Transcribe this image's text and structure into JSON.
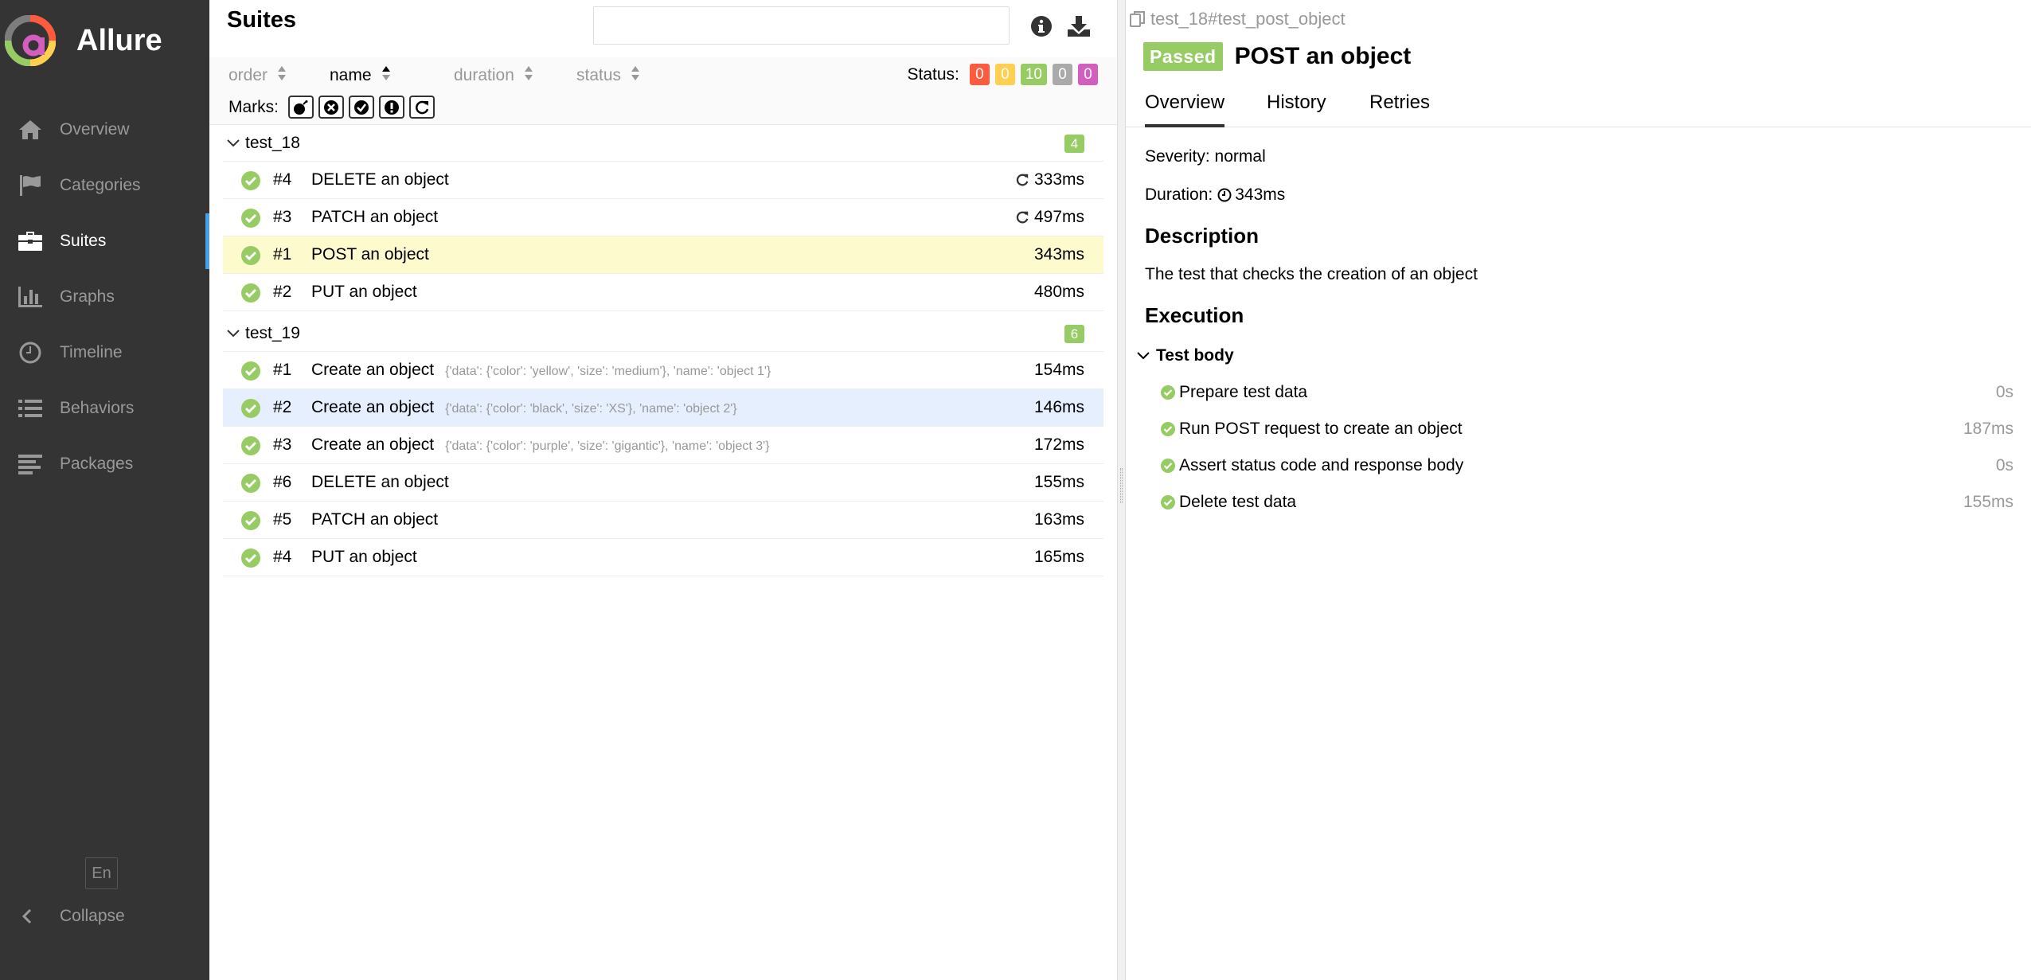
{
  "brand": {
    "name": "Allure"
  },
  "nav": {
    "items": [
      {
        "label": "Overview",
        "icon": "home-icon"
      },
      {
        "label": "Categories",
        "icon": "flag-icon"
      },
      {
        "label": "Suites",
        "icon": "briefcase-icon",
        "active": true
      },
      {
        "label": "Graphs",
        "icon": "bar-chart-icon"
      },
      {
        "label": "Timeline",
        "icon": "clock-icon"
      },
      {
        "label": "Behaviors",
        "icon": "list-icon"
      },
      {
        "label": "Packages",
        "icon": "align-left-icon"
      }
    ],
    "language": "En",
    "collapse_label": "Collapse"
  },
  "suites": {
    "title": "Suites",
    "search": {
      "value": "",
      "placeholder": ""
    },
    "sorters": [
      {
        "label": "order",
        "active": false
      },
      {
        "label": "name",
        "active": true
      },
      {
        "label": "duration",
        "active": false
      },
      {
        "label": "status",
        "active": false
      }
    ],
    "status_label": "Status:",
    "status_counts": [
      {
        "value": "0",
        "color": "#fd5a3e",
        "name": "failed"
      },
      {
        "value": "0",
        "color": "#ffd050",
        "name": "broken"
      },
      {
        "value": "10",
        "color": "#97cc64",
        "name": "passed"
      },
      {
        "value": "0",
        "color": "#aaaaaa",
        "name": "skipped"
      },
      {
        "value": "0",
        "color": "#d35ebe",
        "name": "unknown"
      }
    ],
    "marks_label": "Marks:",
    "marks": [
      "bomb-icon",
      "times-circle-icon",
      "check-circle-icon",
      "exclamation-circle-icon",
      "refresh-icon"
    ],
    "groups": [
      {
        "name": "test_18",
        "count": "4",
        "tests": [
          {
            "num": "#4",
            "name": "DELETE an object",
            "params": "",
            "duration": "333ms",
            "retried": true
          },
          {
            "num": "#3",
            "name": "PATCH an object",
            "params": "",
            "duration": "497ms",
            "retried": true
          },
          {
            "num": "#1",
            "name": "POST an object",
            "params": "",
            "duration": "343ms",
            "retried": false
          },
          {
            "num": "#2",
            "name": "PUT an object",
            "params": "",
            "duration": "480ms",
            "retried": false
          }
        ]
      },
      {
        "name": "test_19",
        "count": "6",
        "tests": [
          {
            "num": "#1",
            "name": "Create an object",
            "params": "{'data': {'color': 'yellow', 'size': 'medium'}, 'name': 'object 1'}",
            "duration": "154ms",
            "retried": false
          },
          {
            "num": "#2",
            "name": "Create an object",
            "params": "{'data': {'color': 'black', 'size': 'XS'}, 'name': 'object 2'}",
            "duration": "146ms",
            "retried": false
          },
          {
            "num": "#3",
            "name": "Create an object",
            "params": "{'data': {'color': 'purple', 'size': 'gigantic'}, 'name': 'object 3'}",
            "duration": "172ms",
            "retried": false
          },
          {
            "num": "#6",
            "name": "DELETE an object",
            "params": "",
            "duration": "155ms",
            "retried": false
          },
          {
            "num": "#5",
            "name": "PATCH an object",
            "params": "",
            "duration": "163ms",
            "retried": false
          },
          {
            "num": "#4",
            "name": "PUT an object",
            "params": "",
            "duration": "165ms",
            "retried": false
          }
        ]
      }
    ]
  },
  "detail": {
    "breadcrumb": "test_18#test_post_object",
    "status": "Passed",
    "title": "POST an object",
    "tabs": [
      "Overview",
      "History",
      "Retries"
    ],
    "severity_label": "Severity:",
    "severity": "normal",
    "duration_label": "Duration:",
    "duration": "343ms",
    "description_heading": "Description",
    "description": "The test that checks the creation of an object",
    "execution_heading": "Execution",
    "test_body_label": "Test body",
    "steps": [
      {
        "name": "Prepare test data",
        "duration": "0s"
      },
      {
        "name": "Run POST request to create an object",
        "duration": "187ms"
      },
      {
        "name": "Assert status code and response body",
        "duration": "0s"
      },
      {
        "name": "Delete test data",
        "duration": "155ms"
      }
    ]
  }
}
